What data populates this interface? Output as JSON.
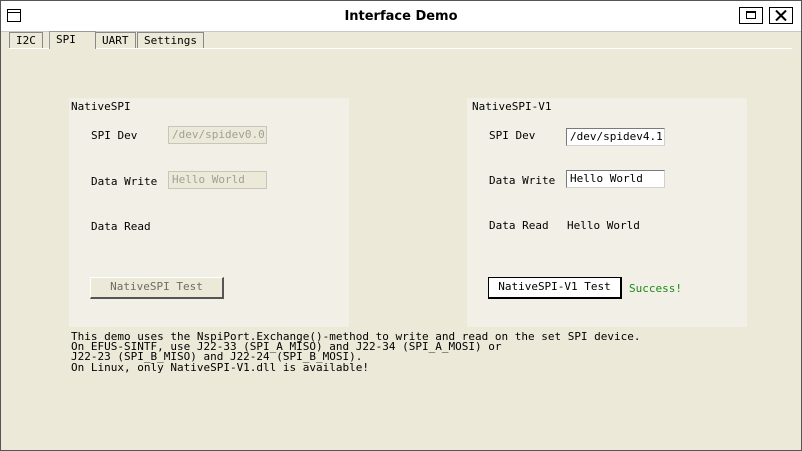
{
  "window": {
    "title": "Interface Demo"
  },
  "tabs": [
    {
      "label": "I2C",
      "active": false
    },
    {
      "label": "SPI",
      "active": true
    },
    {
      "label": "UART",
      "active": false
    },
    {
      "label": "Settings",
      "active": false
    }
  ],
  "left_panel": {
    "title": "NativeSPI",
    "spi_dev_label": "SPI Dev",
    "spi_dev_value": "/dev/spidev0.0",
    "data_write_label": "Data Write",
    "data_write_value": "Hello World",
    "data_read_label": "Data Read",
    "data_read_value": "",
    "test_button_label": "NativeSPI Test",
    "enabled": false
  },
  "right_panel": {
    "title": "NativeSPI-V1",
    "spi_dev_label": "SPI Dev",
    "spi_dev_value": "/dev/spidev4.1",
    "data_write_label": "Data Write",
    "data_write_value": "Hello World",
    "data_read_label": "Data Read",
    "data_read_value": "Hello World",
    "test_button_label": "NativeSPI-V1 Test",
    "status": "Success!",
    "enabled": true
  },
  "info_lines": [
    "This demo uses the NspiPort.Exchange()-method to write and read on the set SPI device.",
    "On EFUS-SINTF, use J22-33 (SPI_A_MISO) and J22-34 (SPI_A_MOSI) or",
    "J22-23 (SPI_B_MISO) and J22-24 (SPI_B_MOSI).",
    "On Linux, only NativeSPI-V1.dll is available!"
  ],
  "colors": {
    "status": "#1a8a1a",
    "background": "#ece9d8",
    "panel": "#f2f0e6"
  },
  "icons": {
    "system_menu": "window-menu-icon",
    "maximize": "maximize-icon",
    "close": "close-icon"
  }
}
